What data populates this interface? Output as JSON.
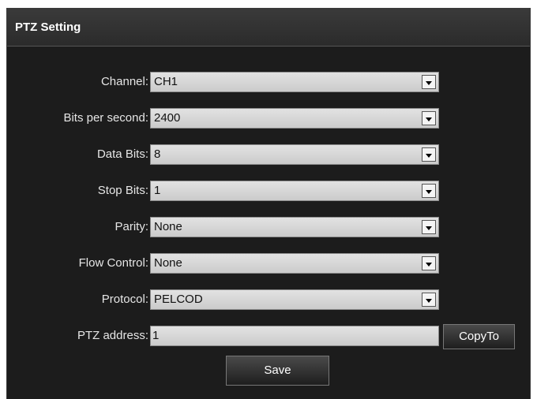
{
  "panel": {
    "title": "PTZ Setting"
  },
  "fields": {
    "channel": {
      "label": "Channel:",
      "value": "CH1"
    },
    "bits_per_second": {
      "label": "Bits per second:",
      "value": "2400"
    },
    "data_bits": {
      "label": "Data Bits:",
      "value": "8"
    },
    "stop_bits": {
      "label": "Stop Bits:",
      "value": "1"
    },
    "parity": {
      "label": "Parity:",
      "value": "None"
    },
    "flow_control": {
      "label": "Flow Control:",
      "value": "None"
    },
    "protocol": {
      "label": "Protocol:",
      "value": "PELCOD"
    },
    "ptz_address": {
      "label": "PTZ address:",
      "value": "1"
    }
  },
  "buttons": {
    "copy_to": "CopyTo",
    "save": "Save"
  },
  "icons": {
    "dropdown": "chevron-down-icon"
  }
}
